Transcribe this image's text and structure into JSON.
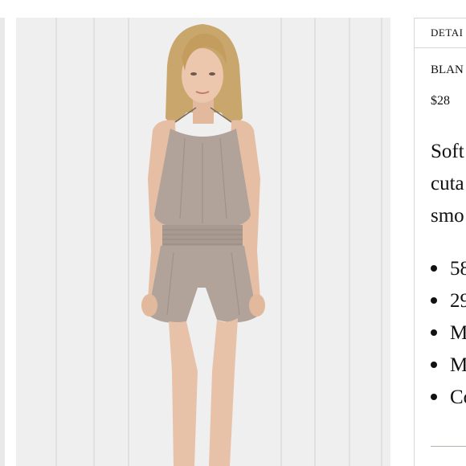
{
  "panel": {
    "tab_label": "DETAI",
    "product_name": "BLAN",
    "price": "$28",
    "description_lines": [
      "Soft",
      "cuta",
      "smo"
    ],
    "features": [
      "58",
      "29",
      "M",
      "M",
      "Co"
    ]
  },
  "photo": {
    "alt": "Model wearing a taupe halter romper against a white wood-panel wall"
  },
  "colors": {
    "romper": "#b1a39a",
    "wall": "#efefef",
    "hair": "#c9a66b",
    "skin": "#e8c2a8"
  }
}
